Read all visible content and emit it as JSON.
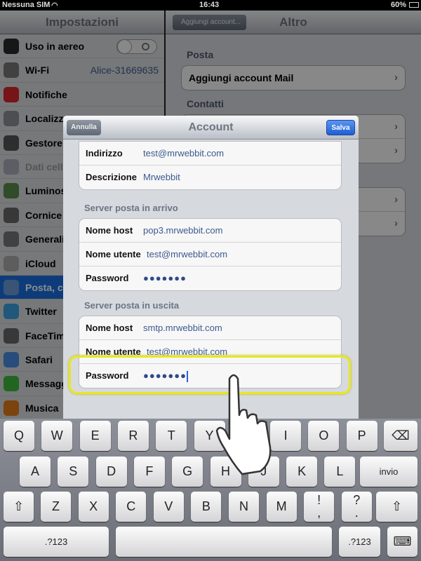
{
  "status": {
    "carrier": "Nessuna SIM",
    "time": "16:43",
    "battery": "60%"
  },
  "sidebar": {
    "title": "Impostazioni",
    "items": [
      {
        "label": "Uso in aereo",
        "icon": "airplane-icon",
        "color": "#2b2b2b",
        "toggle": "off"
      },
      {
        "label": "Wi-Fi",
        "icon": "wifi-icon",
        "color": "#777",
        "value": "Alice-31669635"
      },
      {
        "label": "Notifiche",
        "icon": "notifications-icon",
        "color": "#d9262a"
      },
      {
        "label": "Localizza",
        "icon": "location-icon",
        "color": "#8a8e96"
      },
      {
        "label": "Gestore",
        "icon": "phone-icon",
        "color": "#555"
      },
      {
        "label": "Dati cell",
        "icon": "cellular-icon",
        "color": "#aab",
        "disabled": true
      },
      {
        "label": "Luminos",
        "icon": "brightness-icon",
        "color": "#5a8a4a"
      },
      {
        "label": "Cornice",
        "icon": "picture-frame-icon",
        "color": "#666"
      },
      {
        "label": "Generali",
        "icon": "gear-icon",
        "color": "#777"
      },
      {
        "label": "iCloud",
        "icon": "icloud-icon",
        "color": "#aaa"
      },
      {
        "label": "Posta, c",
        "icon": "mail-icon",
        "color": "#6a9ad8",
        "selected": true
      },
      {
        "label": "Twitter",
        "icon": "twitter-icon",
        "color": "#3aa0e0"
      },
      {
        "label": "FaceTim",
        "icon": "facetime-icon",
        "color": "#666"
      },
      {
        "label": "Safari",
        "icon": "safari-icon",
        "color": "#4a8ae0"
      },
      {
        "label": "Messagg",
        "icon": "messages-icon",
        "color": "#3cb83c"
      },
      {
        "label": "Musica",
        "icon": "music-icon",
        "color": "#e07a1a"
      }
    ]
  },
  "main": {
    "title": "Altro",
    "back": "Aggiungi account...",
    "sections": [
      {
        "label": "Posta",
        "rows": [
          "Aggiungi account Mail"
        ]
      },
      {
        "label": "Contatti",
        "rows": [
          "",
          ""
        ]
      },
      {
        "label": "",
        "rows": [
          "",
          ""
        ]
      }
    ]
  },
  "modal": {
    "title": "Account",
    "cancel": "Annulla",
    "save": "Salva",
    "account": [
      {
        "label": "Indirizzo",
        "value": "test@mrwebbit.com"
      },
      {
        "label": "Descrizione",
        "value": "Mrwebbit"
      }
    ],
    "incoming": {
      "header": "Server posta in arrivo",
      "rows": [
        {
          "label": "Nome host",
          "value": "pop3.mrwebbit.com"
        },
        {
          "label": "Nome utente",
          "value": "test@mrwebbit.com"
        },
        {
          "label": "Password",
          "value": "●●●●●●●"
        }
      ]
    },
    "outgoing": {
      "header": "Server posta in uscita",
      "rows": [
        {
          "label": "Nome host",
          "value": "smtp.mrwebbit.com"
        },
        {
          "label": "Nome utente",
          "value": "test@mrwebbit.com"
        },
        {
          "label": "Password",
          "value": "●●●●●●●"
        }
      ]
    }
  },
  "highlight_color": "#e8e62a",
  "keyboard": {
    "row1": [
      "Q",
      "W",
      "E",
      "R",
      "T",
      "Y",
      "U",
      "I",
      "O",
      "P"
    ],
    "row2": [
      "A",
      "S",
      "D",
      "F",
      "G",
      "H",
      "J",
      "K",
      "L"
    ],
    "enter": "invio",
    "row3": [
      "Z",
      "X",
      "C",
      "V",
      "B",
      "N",
      "M",
      "!\n,",
      "?\n."
    ],
    "shift": "⇧",
    "backspace": "⌫",
    "numbers": ".?123",
    "hide": "⌨"
  }
}
